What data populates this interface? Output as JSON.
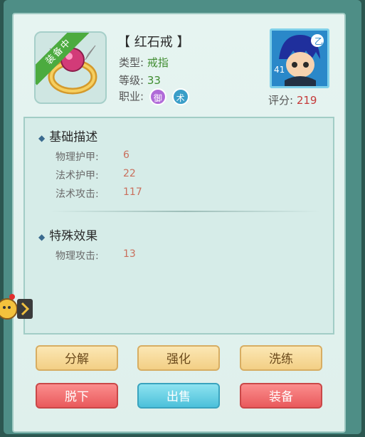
{
  "item": {
    "equipped_tag": "装备中",
    "name": "【 红石戒 】",
    "type_label": "类型:",
    "type_value": "戒指",
    "level_label": "等级:",
    "level_value": "33",
    "job_label": "职业:",
    "jobs": [
      "御",
      "术"
    ]
  },
  "character": {
    "level": "41",
    "score_label": "评分:",
    "score_value": "219"
  },
  "basic": {
    "title": "基础描述",
    "attrs": [
      {
        "label": "物理护甲:",
        "value": "6"
      },
      {
        "label": "法术护甲:",
        "value": "22"
      },
      {
        "label": "法术攻击:",
        "value": "117"
      }
    ]
  },
  "special": {
    "title": "特殊效果",
    "attrs": [
      {
        "label": "物理攻击:",
        "value": "13"
      }
    ]
  },
  "buttons": {
    "decompose": "分解",
    "enhance": "强化",
    "refine": "洗练",
    "unequip": "脱下",
    "sell": "出售",
    "equip": "装备"
  },
  "colors": {
    "gold_button": "#f3cf85",
    "red_button": "#e95a5c",
    "blue_button": "#4cc0da",
    "value_red": "#c53a3a",
    "value_green": "#3f8c2f"
  }
}
